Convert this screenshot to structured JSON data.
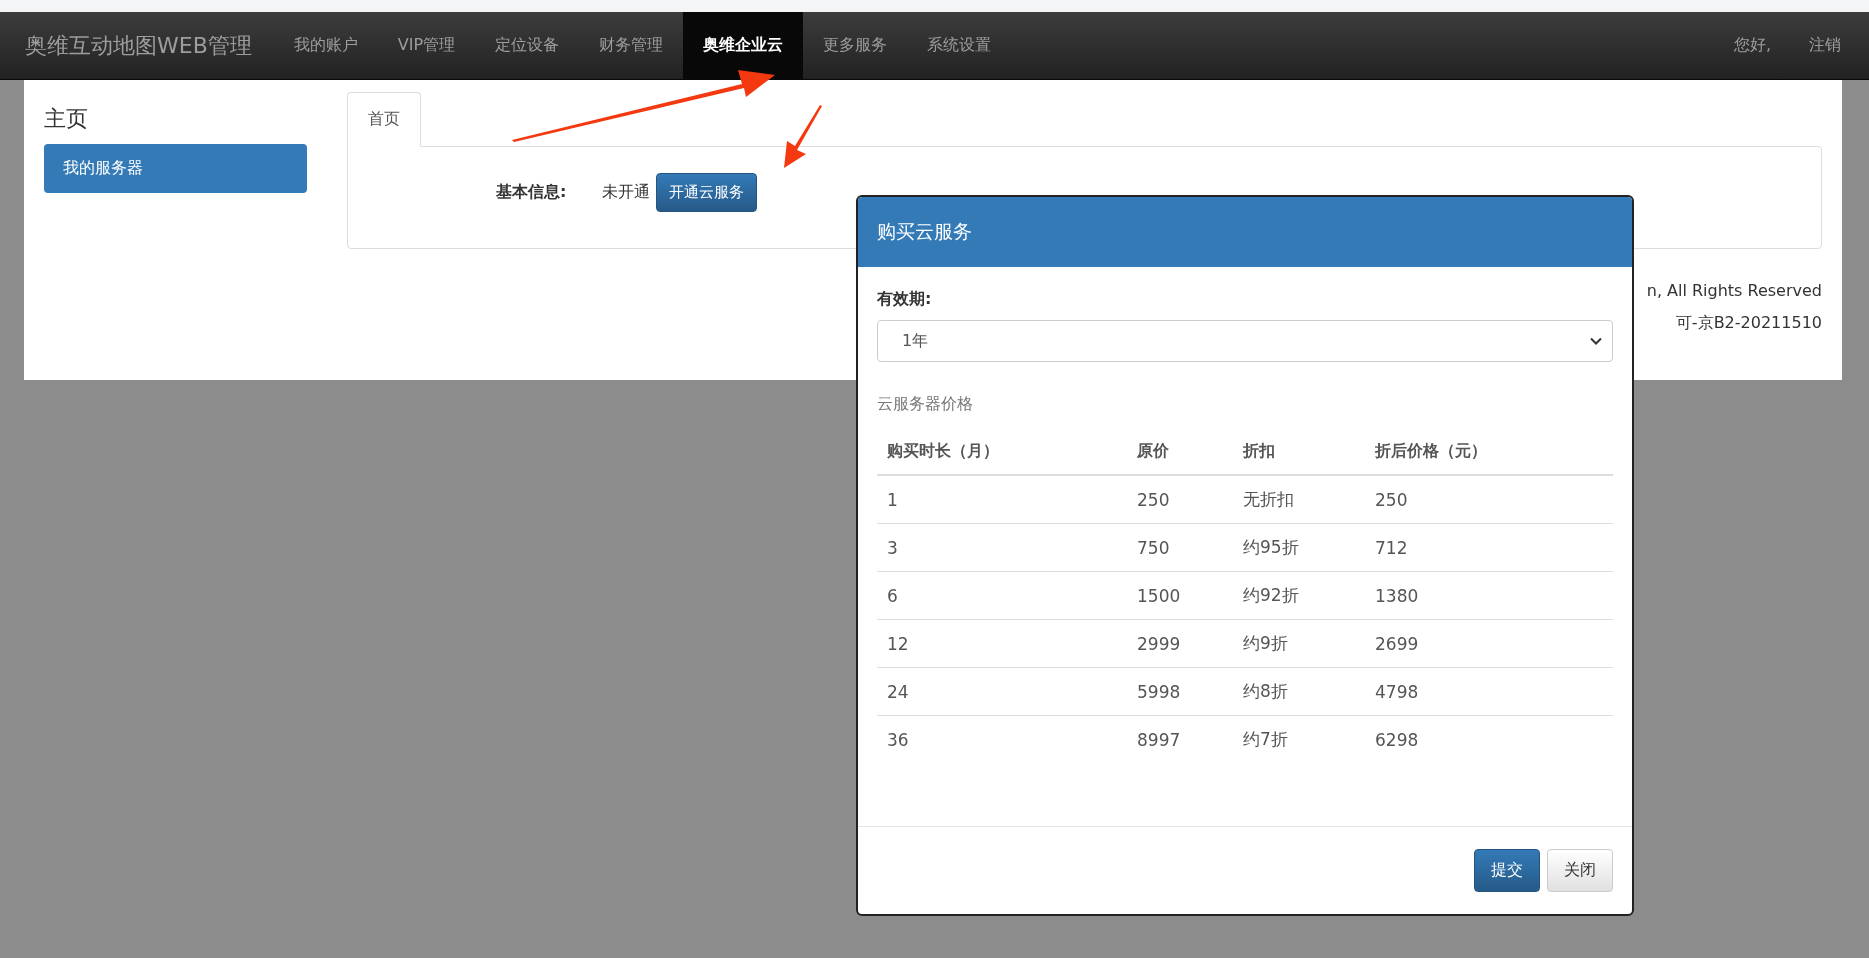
{
  "navbar": {
    "brand": "奥维互动地图WEB管理",
    "items": [
      {
        "label": "我的账户",
        "selected": false
      },
      {
        "label": "VIP管理",
        "selected": false
      },
      {
        "label": "定位设备",
        "selected": false
      },
      {
        "label": "财务管理",
        "selected": false
      },
      {
        "label": "奥维企业云",
        "selected": true
      },
      {
        "label": "更多服务",
        "selected": false
      },
      {
        "label": "系统设置",
        "selected": false
      }
    ],
    "greeting": "您好,",
    "logout": "注销"
  },
  "sidebar": {
    "title": "主页",
    "items": [
      {
        "label": "我的服务器",
        "selected": true
      }
    ]
  },
  "tabs": [
    {
      "label": "首页",
      "selected": true
    }
  ],
  "basic_info": {
    "label": "基本信息:",
    "status": "未开通",
    "button": "开通云服务"
  },
  "footer": [
    "n, All Rights Reserved",
    "可-京B2-20211510"
  ],
  "modal": {
    "title": "购买云服务",
    "period_label": "有效期:",
    "period_value": "1年",
    "price_caption": "云服务器价格",
    "columns": [
      "购买时长（月）",
      "原价",
      "折扣",
      "折后价格（元）"
    ],
    "rows": [
      [
        "1",
        "250",
        "无折扣",
        "250"
      ],
      [
        "3",
        "750",
        "约95折",
        "712"
      ],
      [
        "6",
        "1500",
        "约92折",
        "1380"
      ],
      [
        "12",
        "2999",
        "约9折",
        "2699"
      ],
      [
        "24",
        "5998",
        "约8折",
        "4798"
      ],
      [
        "36",
        "8997",
        "约7折",
        "6298"
      ]
    ],
    "buttons": [
      {
        "label": "提交",
        "kind": "primary"
      },
      {
        "label": "关闭",
        "kind": "default"
      }
    ]
  }
}
